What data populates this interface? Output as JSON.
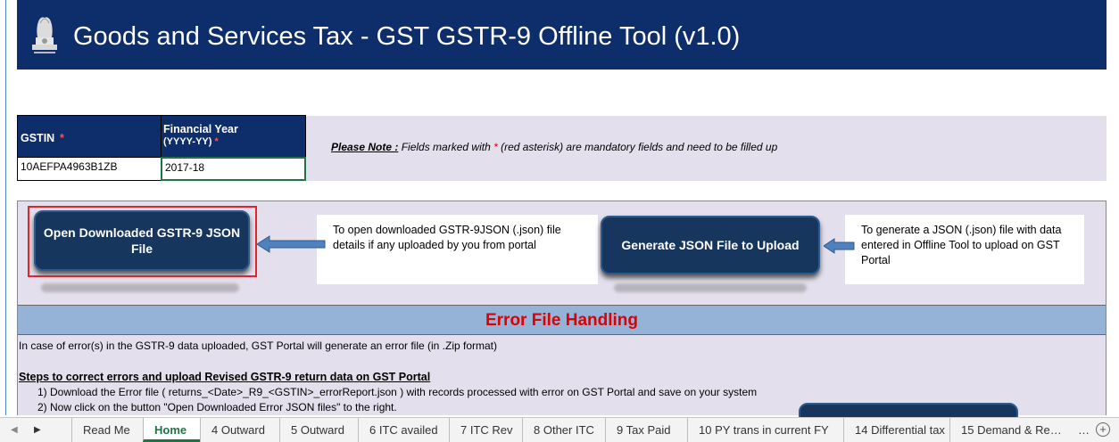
{
  "header": {
    "title": "Goods and Services Tax - GST GSTR-9 Offline Tool (v1.0)"
  },
  "form": {
    "gstin_label": "GSTIN",
    "required_mark": "*",
    "fy_label_line1": "Financial Year",
    "fy_label_line2": "(YYYY-YY)",
    "gstin_value": "10AEFPA4963B1ZB",
    "fy_value": "2017-18"
  },
  "note": {
    "bold": "Please Note :",
    "text_before": " Fields marked with ",
    "asterisk": "*",
    "text_after": " (red asterisk) are mandatory fields and need to be filled up"
  },
  "actions": {
    "open_button": "Open Downloaded GSTR-9 JSON File",
    "open_desc": "To open downloaded GSTR-9JSON (.json) file details if any uploaded by you from portal",
    "generate_button": "Generate JSON File to Upload",
    "generate_desc": "To generate a JSON (.json) file with data entered in Offline Tool to upload on GST Portal"
  },
  "error_section": {
    "title": "Error File Handling",
    "intro": "In case of error(s) in the GSTR-9 data uploaded, GST Portal will generate an error file (in .Zip format)",
    "steps_heading": "Steps to correct errors and upload Revised GSTR-9 return data on GST Portal",
    "step1": "1) Download the Error file  ( returns_<Date>_R9_<GSTIN>_errorReport.json ) with records processed with error on GST Portal and save on your system",
    "step2": "2) Now click on the button \"Open Downloaded Error JSON files\" to the right."
  },
  "tabs": [
    "Read Me",
    "Home",
    "4 Outward",
    "5 Outward",
    "6 ITC availed",
    "7 ITC Rev",
    "8 Other ITC",
    "9 Tax Paid",
    "10 PY trans in current FY",
    "14 Differential tax",
    "15 Demand & Re…"
  ],
  "active_tab": "Home",
  "colors": {
    "header_bg": "#0d2d6b",
    "panel_bg": "#e4dfec",
    "error_band": "#95b3d7",
    "required": "#e00000",
    "active_tab": "#217346"
  }
}
